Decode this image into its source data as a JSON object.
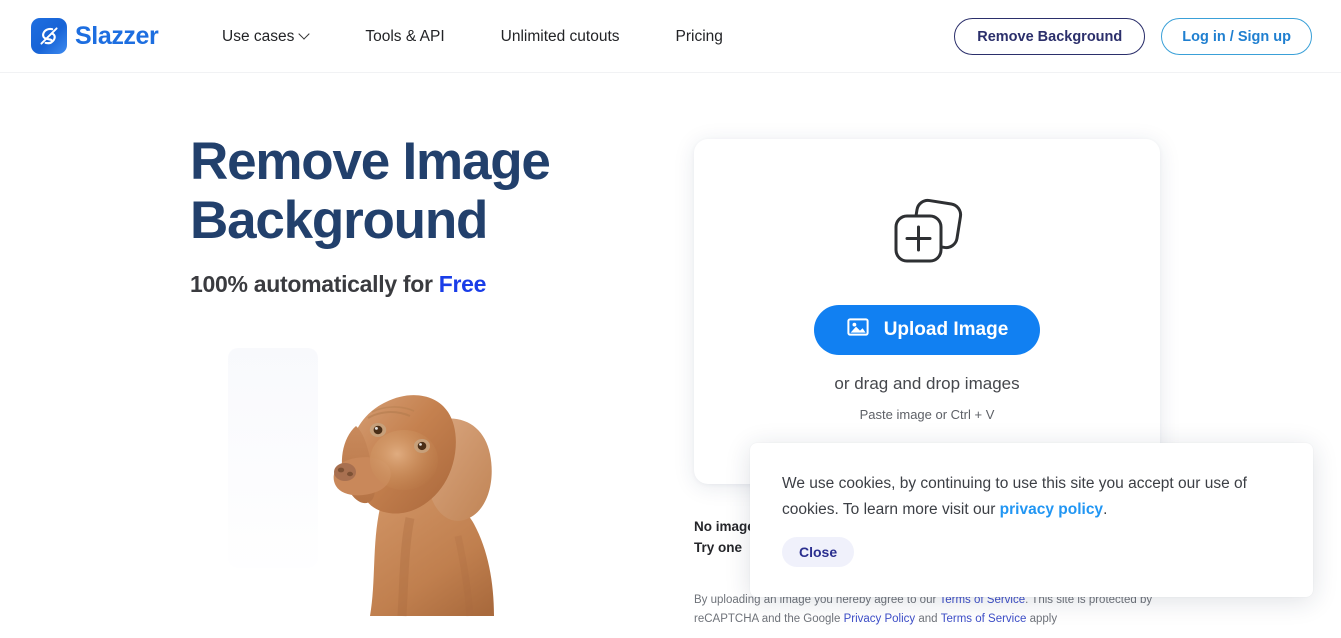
{
  "header": {
    "brand_name": "Slazzer",
    "brand_icon": "slazzer-logo-icon",
    "nav": [
      {
        "label": "Use cases",
        "has_caret": true,
        "name": "use-cases"
      },
      {
        "label": "Tools & API",
        "has_caret": false,
        "name": "tools-api"
      },
      {
        "label": "Unlimited cutouts",
        "has_caret": false,
        "name": "unlimited-cutouts"
      },
      {
        "label": "Pricing",
        "has_caret": false,
        "name": "pricing"
      }
    ],
    "remove_background_label": "Remove Background",
    "login_signup_label": "Log in / Sign up"
  },
  "hero": {
    "title_line1": "Remove Image",
    "title_line2": "Background",
    "subtitle_prefix": "100% automatically for ",
    "subtitle_highlight": "Free",
    "image_alt": "vizsla-dog-cutout"
  },
  "upload": {
    "stack_icon": "add-images-icon",
    "button_icon": "image-icon",
    "button_label": "Upload Image",
    "drag_text": "or drag and drop images",
    "paste_text": "Paste image or Ctrl + V"
  },
  "samples": {
    "line1": "No image?",
    "line2": "Try one"
  },
  "legal": {
    "part1": "By uploading an image you hereby agree to our ",
    "link1": "Terms of Service",
    "part2": ". This site is protected by reCAPTCHA and the Google ",
    "link2": "Privacy Policy",
    "part3": " and ",
    "link3": "Terms of Service",
    "part4": " apply"
  },
  "cookie_banner": {
    "text_part1": "We use cookies, by continuing to use this site you accept our use of cookies. To learn more visit our ",
    "link_label": "privacy policy",
    "text_part2": ".",
    "close_label": "Close"
  },
  "colors": {
    "brand_blue": "#1d6ee0",
    "accent_blue": "#1180f2",
    "navy": "#22406c",
    "free_blue": "#1a3de8",
    "link_blue": "#2196f3",
    "close_bg": "#f0f1fb",
    "close_text": "#2b2f8f"
  }
}
